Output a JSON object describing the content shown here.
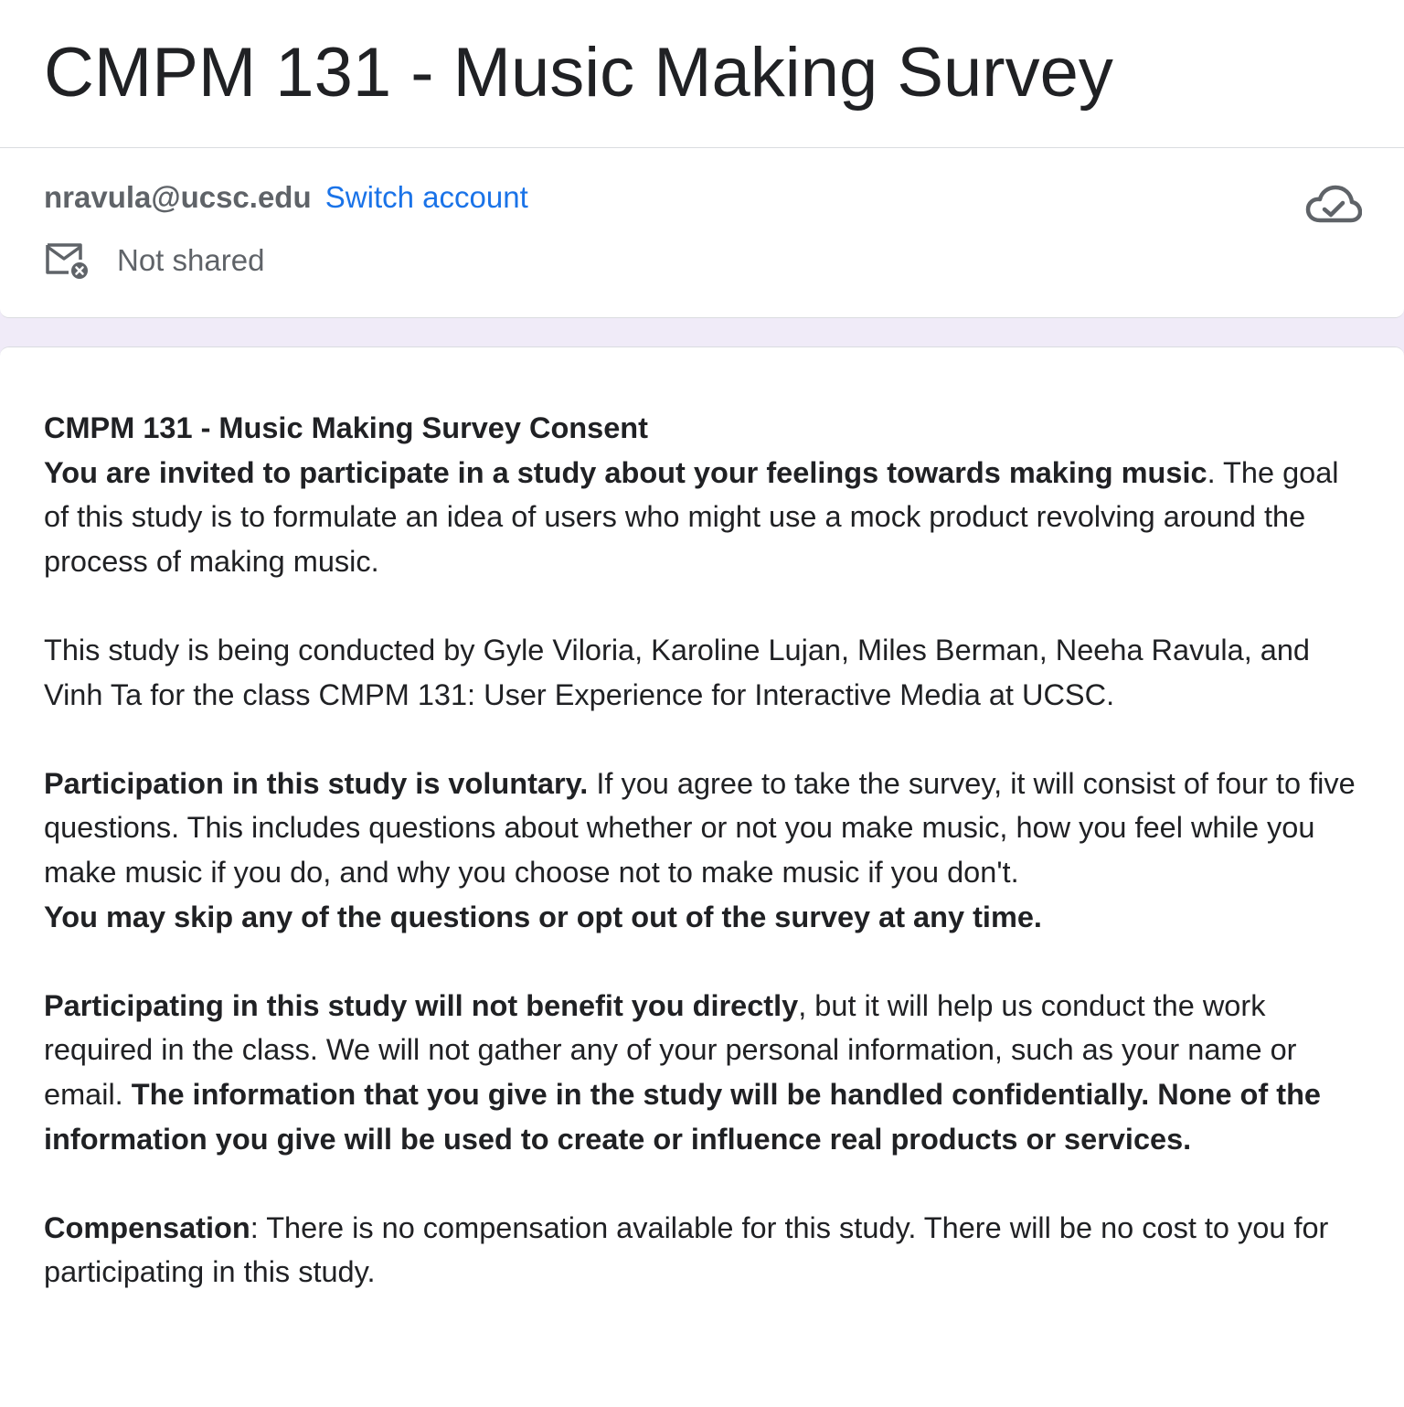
{
  "form": {
    "title": "CMPM 131 - Music Making Survey"
  },
  "account": {
    "email": "nravula@ucsc.edu",
    "switch_label": "Switch account",
    "shared_status": "Not shared"
  },
  "icons": {
    "cloud": "cloud-check-icon",
    "mail": "mail-not-shared-icon"
  },
  "colors": {
    "link": "#1a73e8",
    "background": "#f0ebf8"
  },
  "description": {
    "heading": "CMPM 131 - Music Making Survey Consent",
    "p1_bold": "You are invited to participate in a study about your feelings towards making music",
    "p1_text": ". The goal of this study is to formulate an idea of users who might use a mock product revolving around the process of making music.",
    "p2_text": "This study is being conducted by Gyle Viloria, Karoline Lujan, Miles Berman, Neeha Ravula, and Vinh Ta for the class CMPM 131: User Experience for Interactive Media at UCSC.",
    "p3_bold": "Participation in this study is voluntary.",
    "p3_text": " If you agree to take the survey, it will consist of four to five questions. This includes questions about whether or not you make music, how you feel while you make music if you do, and why you choose not to make music if you don't.",
    "p3_bold2": "You may skip any of the questions or opt out of the survey at any time.",
    "p4_bold": "Participating in this study will not benefit you directly",
    "p4_text": ", but it will help us conduct the work required in the class. We will not gather any of your personal information, such as your name or email. ",
    "p4_bold2": "The information that you give in the study will be handled confidentially. None of the information you give will be used to create or influence real products or services.",
    "p5_bold": "Compensation",
    "p5_text": ": There is no compensation available for this study. There will be no cost to you for participating in this study."
  }
}
